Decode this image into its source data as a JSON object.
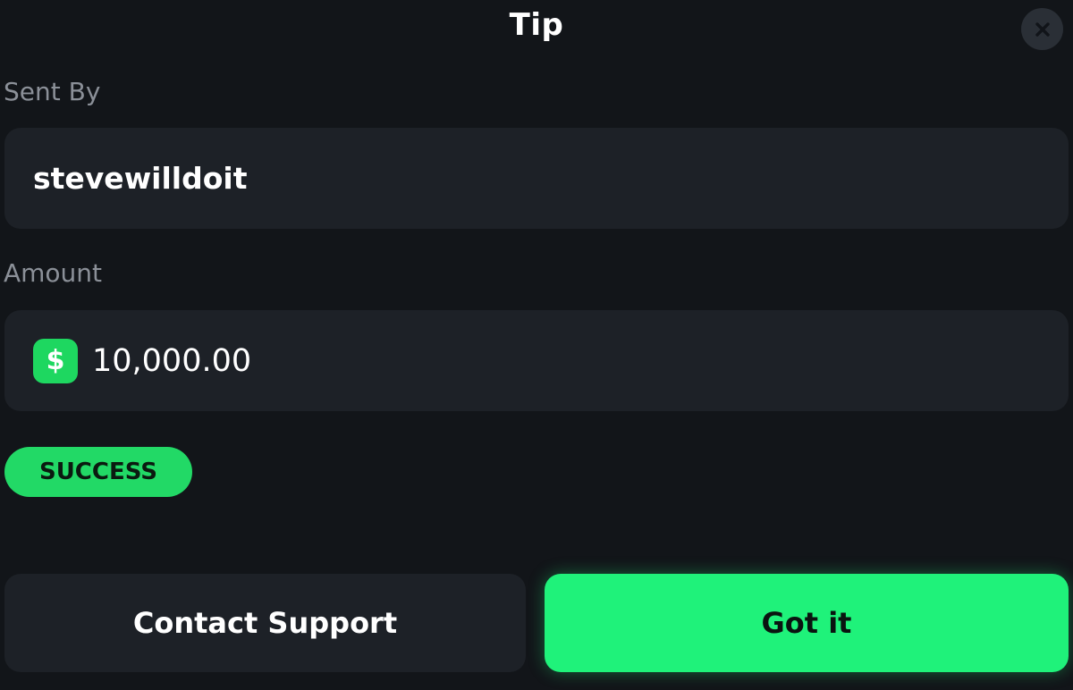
{
  "modal": {
    "title": "Tip",
    "close_icon": "close-icon"
  },
  "sent_by": {
    "label": "Sent By",
    "value": "stevewilldoit"
  },
  "amount": {
    "label": "Amount",
    "currency_symbol": "$",
    "currency_icon": "dollar-icon",
    "value": "10,000.00"
  },
  "status": {
    "label": "SUCCESS",
    "color": "#22d966"
  },
  "actions": {
    "support_label": "Contact Support",
    "confirm_label": "Got it",
    "confirm_color": "#1ff27a"
  },
  "colors": {
    "background": "#121519",
    "field_background": "#1d2127",
    "label_text": "#8b9098"
  }
}
